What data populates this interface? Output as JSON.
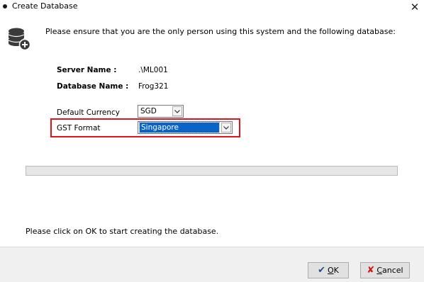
{
  "window": {
    "title": "Create Database",
    "close_glyph": "✕"
  },
  "intro": {
    "icon": "database-add-icon",
    "text": "Please ensure that you are the only person using this system and the following database:"
  },
  "info": {
    "server_label": "Server Name :",
    "server_value": ".\\ML001",
    "database_label": "Database Name :",
    "database_value": "Frog321"
  },
  "fields": {
    "currency_label": "Default Currency",
    "currency_value": "SGD",
    "gst_label": "GST Format",
    "gst_value": "Singapore"
  },
  "progress": {
    "value": 0
  },
  "footer": {
    "message": "Please click on OK to start creating the database."
  },
  "buttons": {
    "ok_label": "OK",
    "ok_icon": "checkmark-icon",
    "ok_glyph": "✔",
    "ok_color": "#1f4e8c",
    "cancel_label": "Cancel",
    "cancel_icon": "x-icon",
    "cancel_glyph": "✘",
    "cancel_color": "#d11a1a"
  },
  "colors": {
    "highlight_border": "#e0141b",
    "selection": "#0a64c8"
  }
}
